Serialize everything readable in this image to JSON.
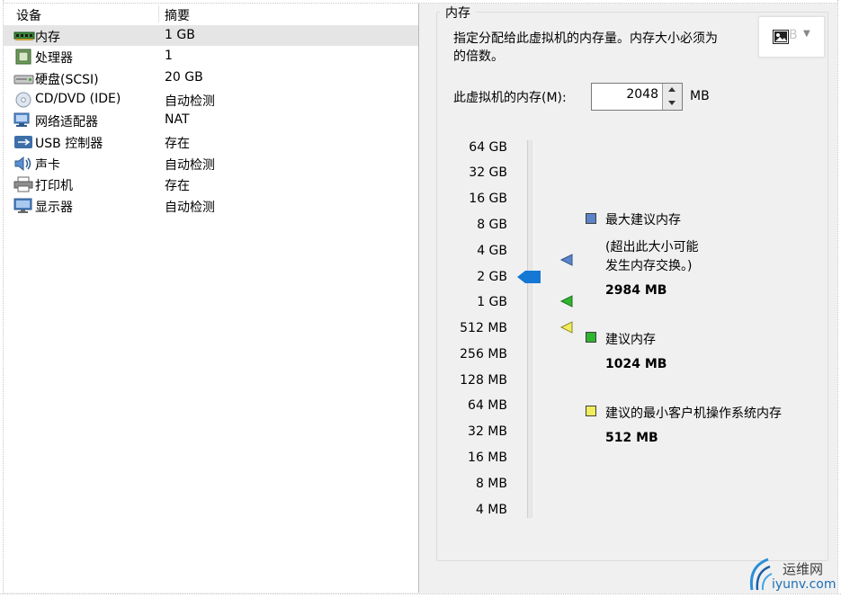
{
  "device_list": {
    "headers": {
      "device": "设备",
      "summary": "摘要"
    },
    "items": [
      {
        "name": "内存",
        "summary": "1 GB",
        "icon": "memory-icon",
        "selected": true
      },
      {
        "name": "处理器",
        "summary": "1",
        "icon": "processor-icon"
      },
      {
        "name": "硬盘(SCSI)",
        "summary": "20 GB",
        "icon": "hard-disk-icon"
      },
      {
        "name": "CD/DVD (IDE)",
        "summary": "自动检测",
        "icon": "cd-dvd-icon"
      },
      {
        "name": "网络适配器",
        "summary": "NAT",
        "icon": "network-adapter-icon"
      },
      {
        "name": "USB 控制器",
        "summary": "存在",
        "icon": "usb-icon"
      },
      {
        "name": "声卡",
        "summary": "自动检测",
        "icon": "sound-card-icon"
      },
      {
        "name": "打印机",
        "summary": "存在",
        "icon": "printer-icon"
      },
      {
        "name": "显示器",
        "summary": "自动检测",
        "icon": "display-icon"
      }
    ]
  },
  "memory_panel": {
    "title": "内存",
    "description_line1": "指定分配给此虚拟机的内存量。内存大小必须为",
    "description_line2": "的倍数。",
    "image_button_ghost_text": "B",
    "memory_label": "此虚拟机的内存(M):",
    "memory_value": "2048",
    "memory_unit": "MB",
    "slider": {
      "ticks": [
        "64 GB",
        "32 GB",
        "16 GB",
        "8 GB",
        "4 GB",
        "2 GB",
        "1 GB",
        "512 MB",
        "256 MB",
        "128 MB",
        "64 MB",
        "32 MB",
        "16 MB",
        "8 MB",
        "4 MB"
      ],
      "current_value": "2 GB"
    },
    "legend": {
      "max_title": "最大建议内存",
      "max_note_line1": "(超出此大小可能",
      "max_note_line2": "发生内存交换。)",
      "max_value": "2984 MB",
      "rec_title": "建议内存",
      "rec_value": "1024 MB",
      "min_title": "建议的最小客户机操作系统内存",
      "min_value": "512 MB"
    },
    "colors": {
      "max": "#5b84c8",
      "recommended": "#2fb52f",
      "minimum": "#f1ec5c",
      "thumb": "#1478d4"
    }
  },
  "watermark": {
    "cn": "运维网",
    "en": "iyunv.com"
  }
}
